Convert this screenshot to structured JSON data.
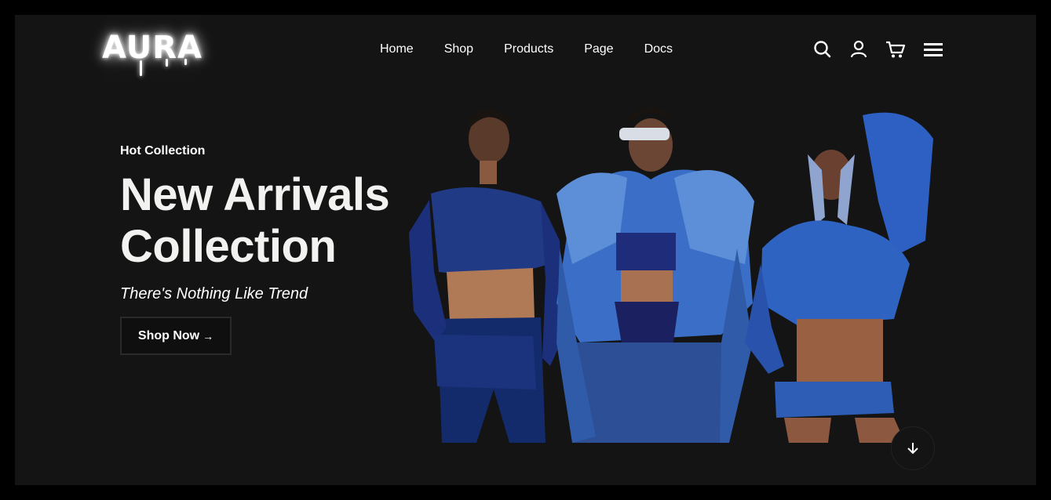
{
  "brand": {
    "logo_text": "AURA"
  },
  "nav": {
    "items": [
      {
        "label": "Home"
      },
      {
        "label": "Shop"
      },
      {
        "label": "Products"
      },
      {
        "label": "Page"
      },
      {
        "label": "Docs"
      }
    ]
  },
  "header_icons": [
    "search-icon",
    "user-icon",
    "cart-icon",
    "menu-icon"
  ],
  "hero": {
    "eyebrow": "Hot Collection",
    "headline_line1": "New Arrivals",
    "headline_line2": "Collection",
    "tagline": "There's Nothing Like Trend",
    "cta_label": "Shop Now",
    "cta_arrow": "→",
    "scroll_icon": "arrow-down-icon",
    "image_alt": "three models in blue denim outfits"
  },
  "colors": {
    "page_bg": "#141414",
    "outer_bg": "#000000",
    "text": "#ffffff",
    "headline": "#f2f3f0",
    "accent_blue": "#1f3f8f"
  }
}
